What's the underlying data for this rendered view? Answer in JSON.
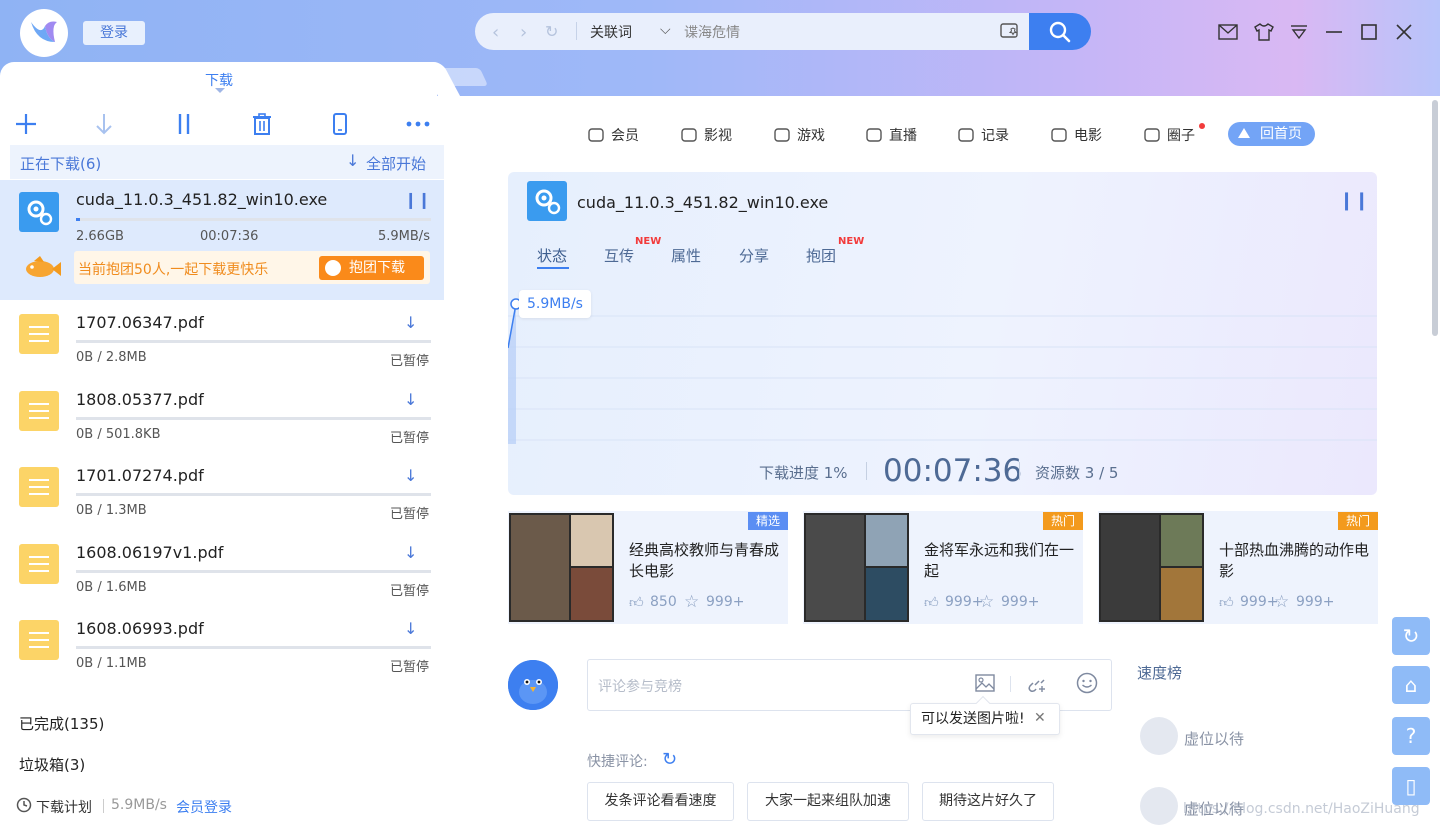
{
  "header": {
    "login_label": "登录",
    "search_keyword_type": "关联词",
    "search_input_value": "谍海危情"
  },
  "tabs": {
    "active_label": "下载"
  },
  "downloads": {
    "heading": "正在下载(6)",
    "start_all_label": "全部开始",
    "active": {
      "name": "cuda_11.0.3_451.82_win10.exe",
      "size": "2.66GB",
      "time": "00:07:36",
      "speed": "5.9MB/s",
      "progress": 0.01,
      "group_text": "当前抱团50人,一起下载更快乐",
      "group_button": "抱团下载"
    },
    "items": [
      {
        "name": "1707.06347.pdf",
        "meta": "0B / 2.8MB",
        "status": "已暂停"
      },
      {
        "name": "1808.05377.pdf",
        "meta": "0B / 501.8KB",
        "status": "已暂停"
      },
      {
        "name": "1701.07274.pdf",
        "meta": "0B / 1.3MB",
        "status": "已暂停"
      },
      {
        "name": "1608.06197v1.pdf",
        "meta": "0B / 1.6MB",
        "status": "已暂停"
      },
      {
        "name": "1608.06993.pdf",
        "meta": "0B / 1.1MB",
        "status": "已暂停"
      }
    ],
    "completed_label": "已完成(135)",
    "trash_label": "垃圾箱(3)"
  },
  "statusbar": {
    "plan_label": "下载计划",
    "speed": "5.9MB/s",
    "member_login": "会员登录"
  },
  "right_nav": [
    {
      "label": "会员",
      "icon": "vip-icon"
    },
    {
      "label": "影视",
      "icon": "film-icon"
    },
    {
      "label": "游戏",
      "icon": "gamepad-icon"
    },
    {
      "label": "直播",
      "icon": "tv-icon"
    },
    {
      "label": "记录",
      "icon": "cloud-icon"
    },
    {
      "label": "电影",
      "icon": "movie-camera-icon"
    },
    {
      "label": "圈子",
      "icon": "circle-icon"
    }
  ],
  "home_button": "回首页",
  "detail": {
    "file_name": "cuda_11.0.3_451.82_win10.exe",
    "tabs": [
      "状态",
      "互传",
      "属性",
      "分享",
      "抱团"
    ],
    "new_tag": "NEW",
    "speed_label": "5.9MB/s",
    "progress_label": "下载进度 1%",
    "elapsed": "00:07:36",
    "sources_label": "资源数 3 / 5"
  },
  "cards": [
    {
      "badge": "精选",
      "badge_color": "#5b8ef3",
      "title": "经典高校教师与青春成长电影",
      "likes": "850",
      "stars": "999+"
    },
    {
      "badge": "热门",
      "badge_color": "#f39a1d",
      "title": "金将军永远和我们在一起",
      "likes": "999+",
      "stars": "999+"
    },
    {
      "badge": "热门",
      "badge_color": "#f39a1d",
      "title": "十部热血沸腾的动作电影",
      "likes": "999+",
      "stars": "999+"
    }
  ],
  "comments": {
    "placeholder": "评论参与竞榜",
    "tooltip": "可以发送图片啦!",
    "quick_label": "快捷评论:",
    "quick_buttons": [
      "发条评论看看速度",
      "大家一起来组队加速",
      "期待这片好久了"
    ]
  },
  "ranking": {
    "title": "速度榜",
    "slots": [
      "虚位以待",
      "虚位以待"
    ]
  },
  "watermark": "https://blog.csdn.net/HaoZiHuang",
  "colors": {
    "accent": "#3d7ff0",
    "orange": "#fa8a1a",
    "paused_icon": "#fcd467"
  }
}
